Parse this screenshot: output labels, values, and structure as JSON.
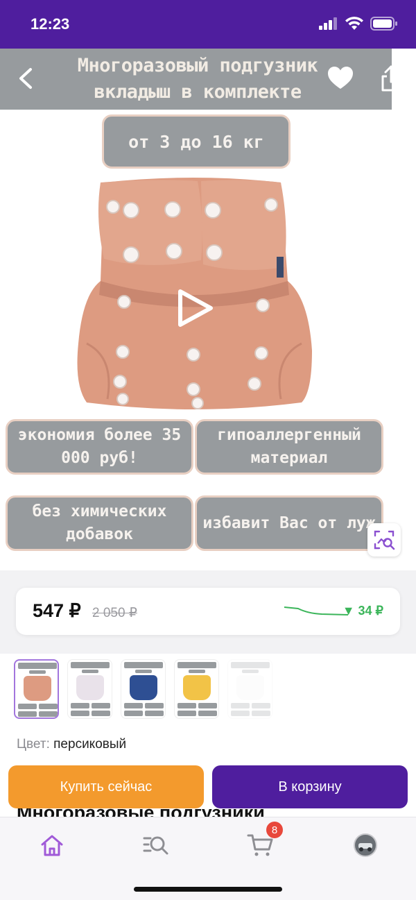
{
  "status_bar": {
    "time": "12:23"
  },
  "hero": {
    "title": "Многоразовый подгузник вкладыш в комплекте",
    "weight_label": "от 3 до 16 кг",
    "features": [
      "экономия более 35 000 руб!",
      "гипоаллергенный материал",
      "без химических добавок",
      "избавит Вас от луж"
    ],
    "product_color": "#dd9b81"
  },
  "price": {
    "current": "547 ₽",
    "old": "2 050 ₽",
    "drop": "▼ 34 ₽",
    "drop_color": "#3bb55a"
  },
  "thumbnails": [
    {
      "color": "#dd9b81",
      "selected": true
    },
    {
      "color": "#e9e2ea",
      "selected": false
    },
    {
      "color": "#2e4f93",
      "selected": false
    },
    {
      "color": "#f2c347",
      "selected": false
    },
    {
      "color": "#f4f4f4",
      "selected": false
    }
  ],
  "color_selector": {
    "label": "Цвет:",
    "value": "персиковый"
  },
  "product_title_partial": "Многоразовые подгузники",
  "actions": {
    "buy_now": "Купить сейчас",
    "add_to_cart": "В корзину"
  },
  "tabbar": {
    "items": [
      "home-icon",
      "catalog-search-icon",
      "cart-icon",
      "profile-avatar"
    ],
    "cart_badge": "8",
    "accent": "#a05ad8"
  },
  "colors": {
    "brand": "#4f1e9e",
    "buy": "#f39a2d"
  }
}
